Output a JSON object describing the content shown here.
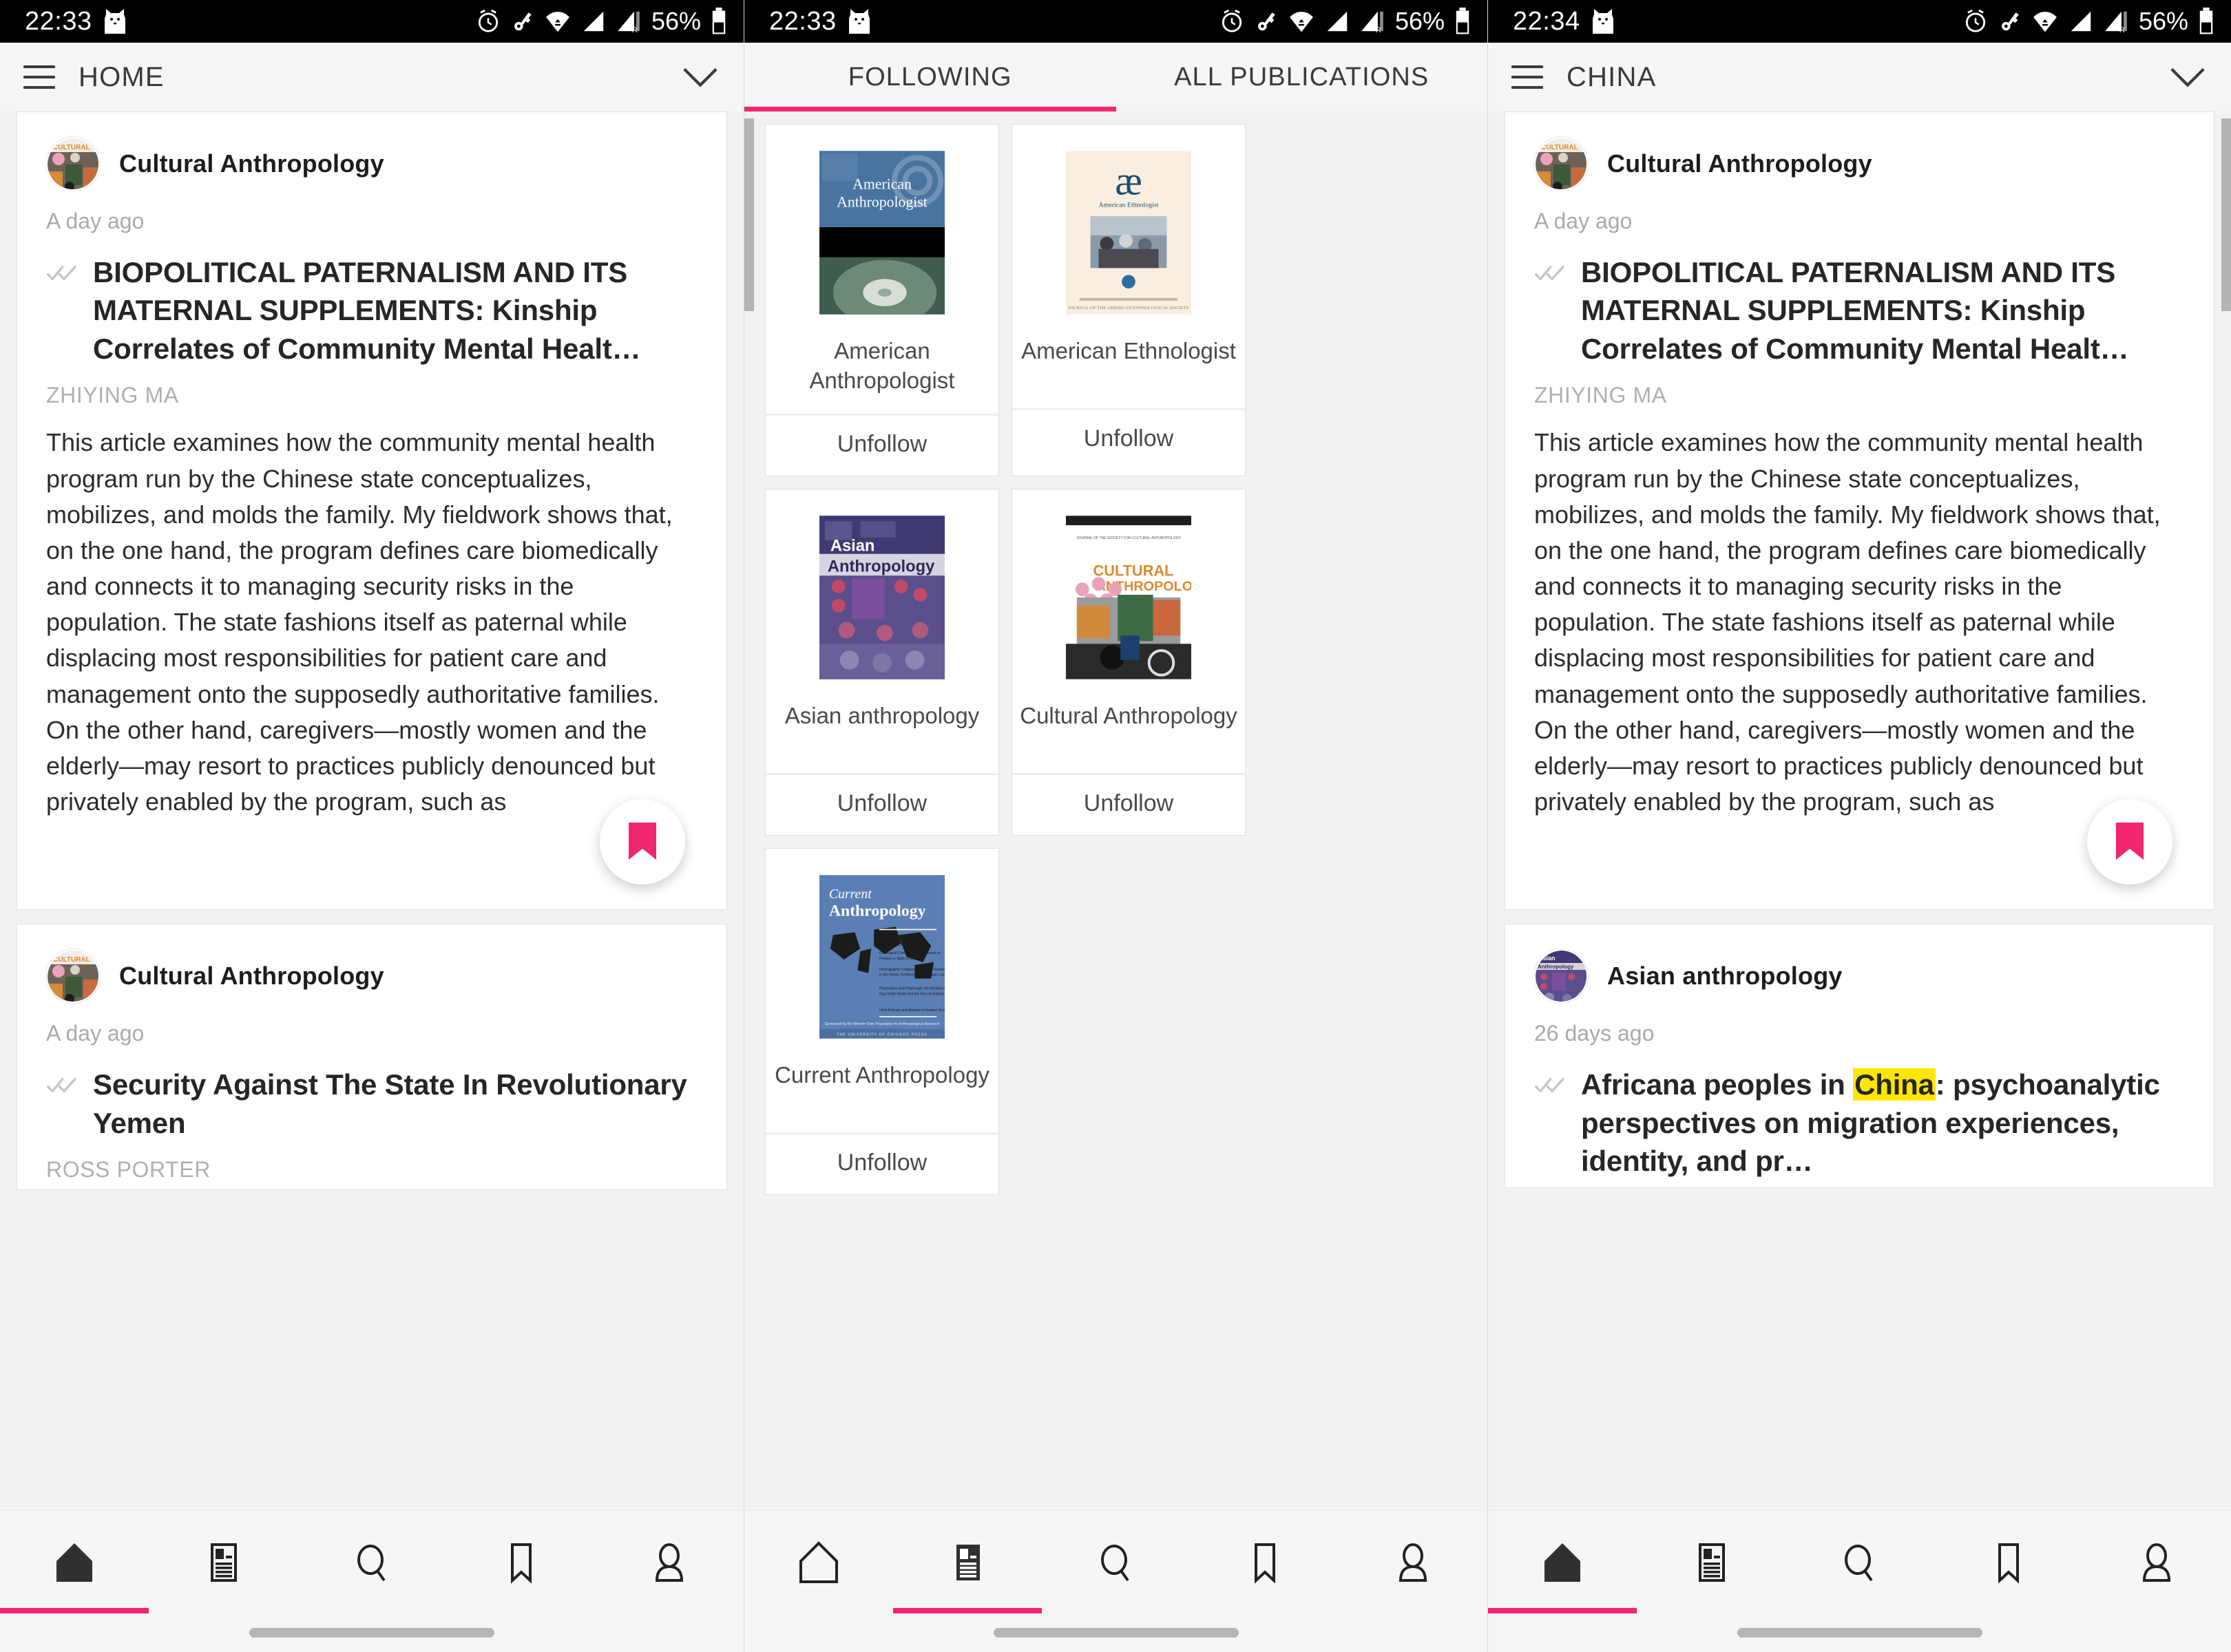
{
  "accent_pink": "#f0266f",
  "highlight_yellow": "#ffe600",
  "screens": [
    {
      "id": "home",
      "statusbar": {
        "time": "22:33",
        "battery": "56%",
        "cat_icon": "cat-icon",
        "alarm_icon": "alarm-icon",
        "key_icon": "key-icon",
        "wifi_icon": "wifi-icon",
        "signal_icon": "signal-icon",
        "signal2_icon": "signal-roaming-icon",
        "battery_icon": "battery-icon"
      },
      "appbar": {
        "menu_icon": "hamburger-icon",
        "title": "HOME",
        "chevron_icon": "chevron-down-icon"
      },
      "cards": [
        {
          "publication": "Cultural Anthropology",
          "avatar": "cultural-anthropology-cover",
          "time": "A day ago",
          "read_icon": "double-check-icon",
          "title": "BIOPOLITICAL PATERNALISM AND ITS MATERNAL SUPPLEMENTS: Kinship Correlates of Community Mental Healt…",
          "author": "ZHIYING MA",
          "excerpt": "This article examines how the community mental health program run by the Chinese state conceptualizes, mobilizes, and molds the family. My fieldwork shows that, on the one hand, the program defines care biomedically and connects it to managing security risks in the population. The state fashions itself as paternal while displacing most responsibilities for patient care and management onto the supposedly authoritative families. On the other hand, caregivers—mostly women and the elderly—may resort to practices publicly denounced but privately enabled by the program, such as",
          "fab_icon": "bookmark-filled-icon"
        },
        {
          "publication": "Cultural Anthropology",
          "avatar": "cultural-anthropology-cover",
          "time": "A day ago",
          "read_icon": "double-check-icon",
          "title": "Security Against The State In Revolutionary Yemen",
          "author": "ROSS PORTER",
          "excerpt": "",
          "fab_icon": ""
        }
      ],
      "bottom_nav": [
        {
          "icon": "home-icon",
          "active": true
        },
        {
          "icon": "newspaper-icon",
          "active": false
        },
        {
          "icon": "search-icon",
          "active": false
        },
        {
          "icon": "bookmark-icon",
          "active": false
        },
        {
          "icon": "profile-icon",
          "active": false
        }
      ]
    },
    {
      "id": "publications",
      "statusbar": {
        "time": "22:33",
        "battery": "56%",
        "cat_icon": "cat-icon",
        "alarm_icon": "alarm-icon",
        "key_icon": "key-icon",
        "wifi_icon": "wifi-icon",
        "signal_icon": "signal-icon",
        "signal2_icon": "signal-roaming-icon",
        "battery_icon": "battery-icon"
      },
      "tabs": [
        {
          "label": "FOLLOWING",
          "active": true
        },
        {
          "label": "ALL PUBLICATIONS",
          "active": false
        }
      ],
      "journals": [
        {
          "name": "American Anthropologist",
          "cover": "american-anthropologist-cover",
          "action": "Unfollow"
        },
        {
          "name": "American Ethnologist",
          "cover": "american-ethnologist-cover",
          "action": "Unfollow"
        },
        {
          "name": "Asian anthropology",
          "cover": "asian-anthropology-cover",
          "action": "Unfollow"
        },
        {
          "name": "Cultural Anthropology",
          "cover": "cultural-anthropology-cover",
          "action": "Unfollow"
        },
        {
          "name": "Current Anthropology",
          "cover": "current-anthropology-cover",
          "action": "Unfollow"
        }
      ],
      "bottom_nav": [
        {
          "icon": "home-icon",
          "active": false
        },
        {
          "icon": "newspaper-icon",
          "active": true
        },
        {
          "icon": "search-icon",
          "active": false
        },
        {
          "icon": "bookmark-icon",
          "active": false
        },
        {
          "icon": "profile-icon",
          "active": false
        }
      ]
    },
    {
      "id": "china",
      "statusbar": {
        "time": "22:34",
        "battery": "56%",
        "cat_icon": "cat-icon",
        "alarm_icon": "alarm-icon",
        "key_icon": "key-icon",
        "wifi_icon": "wifi-icon",
        "signal_icon": "signal-icon",
        "signal2_icon": "signal-roaming-icon",
        "battery_icon": "battery-icon"
      },
      "appbar": {
        "menu_icon": "hamburger-icon",
        "title": "CHINA",
        "chevron_icon": "chevron-down-icon"
      },
      "cards": [
        {
          "publication": "Cultural Anthropology",
          "avatar": "cultural-anthropology-cover",
          "time": "A day ago",
          "read_icon": "double-check-icon",
          "title": "BIOPOLITICAL PATERNALISM AND ITS MATERNAL SUPPLEMENTS: Kinship Correlates of Community Mental Healt…",
          "author": "ZHIYING MA",
          "excerpt": "This article examines how the community mental health program run by the Chinese state conceptualizes, mobilizes, and molds the family. My fieldwork shows that, on the one hand, the program defines care biomedically and connects it to managing security risks in the population. The state fashions itself as paternal while displacing most responsibilities for patient care and management onto the supposedly authoritative families. On the other hand, caregivers—mostly women and the elderly—may resort to practices publicly denounced but privately enabled by the program, such as",
          "fab_icon": "bookmark-filled-icon"
        },
        {
          "publication": "Asian anthropology",
          "avatar": "asian-anthropology-cover",
          "time": "26 days ago",
          "read_icon": "double-check-icon",
          "title_pre": "Africana peoples in ",
          "title_highlight": "China",
          "title_post": ": psychoanalytic perspectives on migration experiences, identity, and pr…",
          "author": "",
          "excerpt": "",
          "fab_icon": ""
        }
      ],
      "bottom_nav": [
        {
          "icon": "home-icon",
          "active": true
        },
        {
          "icon": "newspaper-icon",
          "active": false
        },
        {
          "icon": "search-icon",
          "active": false
        },
        {
          "icon": "bookmark-icon",
          "active": false
        },
        {
          "icon": "profile-icon",
          "active": false
        }
      ]
    }
  ]
}
